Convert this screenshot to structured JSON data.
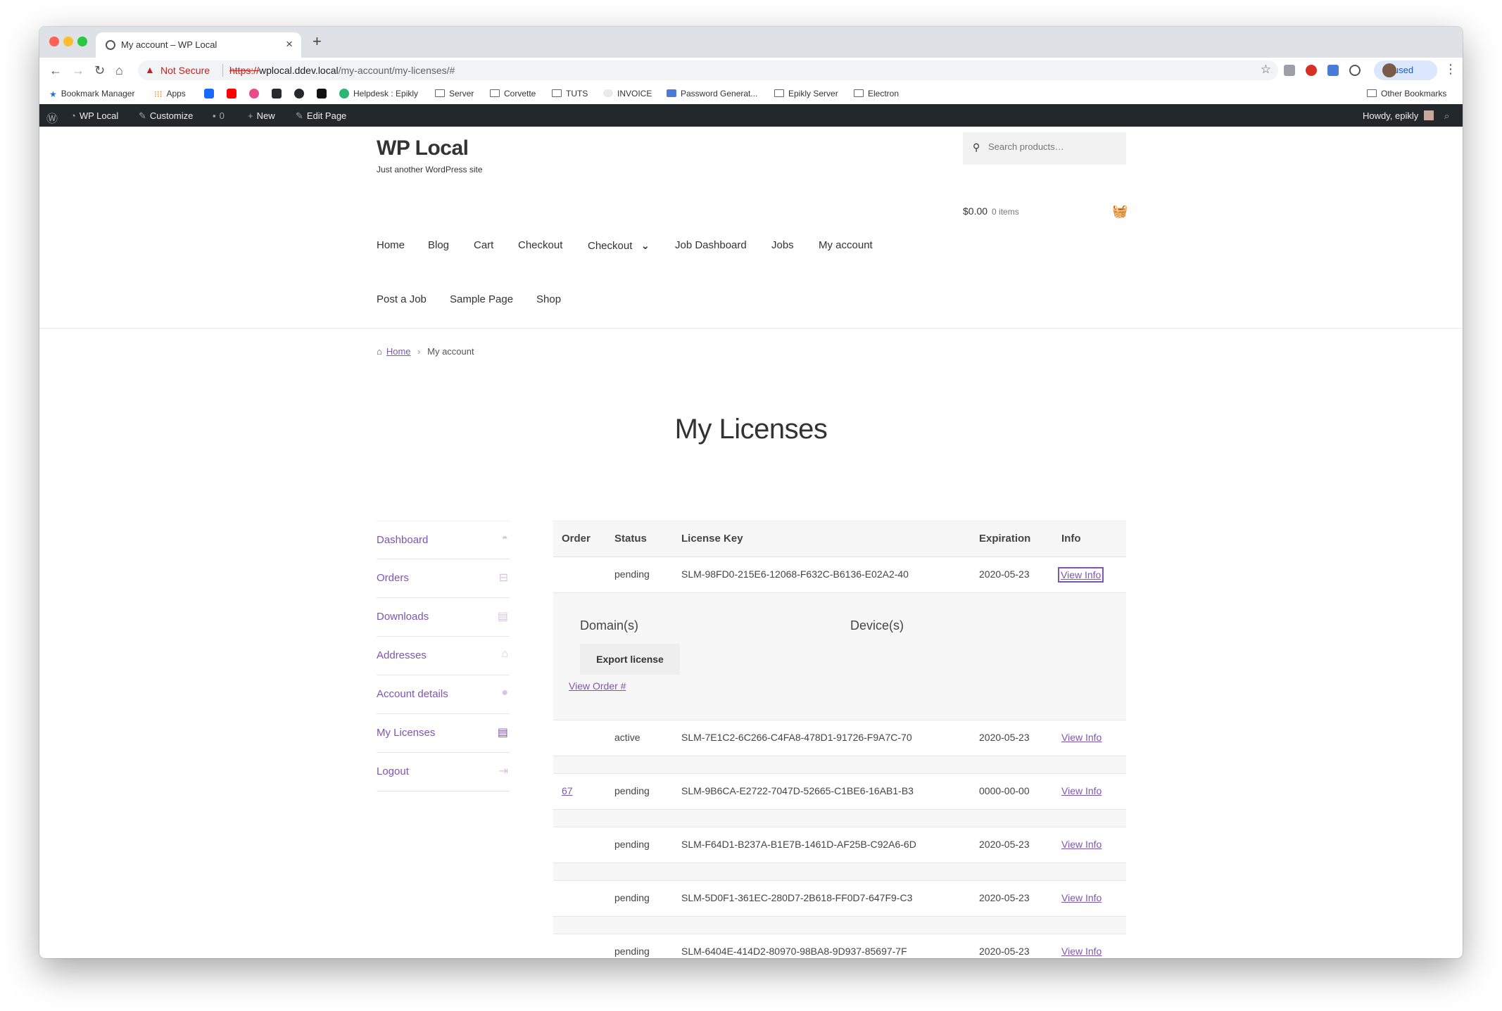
{
  "browser": {
    "tab_title": "My account – WP Local",
    "close_glyph": "×",
    "new_tab_glyph": "+",
    "security_label": "Not Secure",
    "url_scheme": "https://",
    "url_host": "wplocal.ddev.local",
    "url_path": "/my-account/my-licenses/#",
    "profile_label": "Paused",
    "nav_glyphs": {
      "back": "←",
      "forward": "→",
      "reload": "↻",
      "home": "⌂",
      "star": "☆",
      "menu": "⋮",
      "warning": "▲"
    }
  },
  "bookmarks": [
    {
      "label": "Bookmark Manager",
      "icon": "star-icon"
    },
    {
      "label": "Apps",
      "icon": "apps-grid-icon"
    },
    {
      "label": "",
      "icon": "behance-icon"
    },
    {
      "label": "",
      "icon": "youtube-icon"
    },
    {
      "label": "",
      "icon": "dribbble-icon"
    },
    {
      "label": "",
      "icon": "plex-icon"
    },
    {
      "label": "",
      "icon": "github-icon"
    },
    {
      "label": "",
      "icon": "unsplash-icon"
    },
    {
      "label": "Helpdesk : Epikly",
      "icon": "helpdesk-icon"
    },
    {
      "label": "Server",
      "icon": "folder-icon"
    },
    {
      "label": "Corvette",
      "icon": "folder-icon"
    },
    {
      "label": "TUTS",
      "icon": "folder-icon"
    },
    {
      "label": "INVOICE",
      "icon": "cloud-icon"
    },
    {
      "label": "Password Generat...",
      "icon": "lock-icon"
    },
    {
      "label": "Epikly Server",
      "icon": "folder-icon"
    },
    {
      "label": "Electron",
      "icon": "folder-icon"
    }
  ],
  "other_bookmarks": "Other Bookmarks",
  "adminbar": {
    "site_name": "WP Local",
    "customize": "Customize",
    "comments_count": "0",
    "new_label": "New",
    "edit_page": "Edit Page",
    "howdy": "Howdy, epikly"
  },
  "site": {
    "title": "WP Local",
    "tagline": "Just another WordPress site",
    "search_placeholder": "Search products…"
  },
  "menu": {
    "row1": [
      "Home",
      "Blog",
      "Cart",
      "Checkout",
      "Checkout",
      "Job Dashboard",
      "Jobs",
      "My account"
    ],
    "row2": [
      "Post a Job",
      "Sample Page",
      "Shop"
    ],
    "dropdown_glyph": "⌄"
  },
  "cart": {
    "total": "$0.00",
    "items": "0 items"
  },
  "breadcrumb": {
    "home": "Home",
    "separator": "›",
    "current": "My account"
  },
  "page_title": "My Licenses",
  "account_nav": [
    {
      "label": "Dashboard",
      "icon": "dashboard-gauge-icon"
    },
    {
      "label": "Orders",
      "icon": "basket-icon"
    },
    {
      "label": "Downloads",
      "icon": "file-icon"
    },
    {
      "label": "Addresses",
      "icon": "home-icon"
    },
    {
      "label": "Account details",
      "icon": "user-icon"
    },
    {
      "label": "My Licenses",
      "icon": "license-file-icon"
    },
    {
      "label": "Logout",
      "icon": "logout-icon"
    }
  ],
  "table": {
    "headers": {
      "order": "Order",
      "status": "Status",
      "key": "License Key",
      "expiration": "Expiration",
      "info": "Info"
    },
    "view_info": "View Info",
    "rows": [
      {
        "order": "",
        "status": "pending",
        "key": "SLM-98FD0-215E6-12068-F632C-B6136-E02A2-40",
        "expiration": "2020-05-23"
      },
      {
        "order": "",
        "status": "active",
        "key": "SLM-7E1C2-6C266-C4FA8-478D1-91726-F9A7C-70",
        "expiration": "2020-05-23"
      },
      {
        "order": "67",
        "status": "pending",
        "key": "SLM-9B6CA-E2722-7047D-52665-C1BE6-16AB1-B3",
        "expiration": "0000-00-00"
      },
      {
        "order": "",
        "status": "pending",
        "key": "SLM-F64D1-B237A-B1E7B-1461D-AF25B-C92A6-6D",
        "expiration": "2020-05-23"
      },
      {
        "order": "",
        "status": "pending",
        "key": "SLM-5D0F1-361EC-280D7-2B618-FF0D7-647F9-C3",
        "expiration": "2020-05-23"
      },
      {
        "order": "",
        "status": "pending",
        "key": "SLM-6404E-414D2-80970-98BA8-9D937-85697-7F",
        "expiration": "2020-05-23"
      }
    ],
    "detail": {
      "domains_heading": "Domain(s)",
      "devices_heading": "Device(s)",
      "export_button": "Export license",
      "view_order": "View Order #"
    }
  },
  "colors": {
    "accent": "#7f54b3",
    "adminbar": "#23282d"
  }
}
